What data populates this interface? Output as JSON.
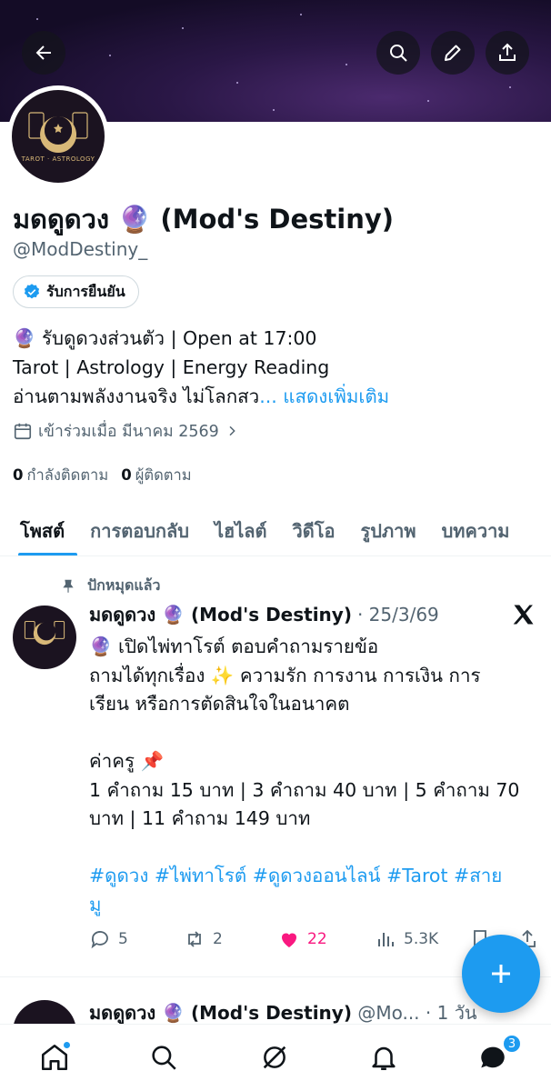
{
  "colors": {
    "accent": "#1d9bf0",
    "text": "#0f1419",
    "muted": "#536471",
    "like": "#f91880"
  },
  "profile": {
    "display_name": "มดดูดวง 🔮 (Mod's Destiny)",
    "handle": "@ModDestiny_",
    "verified_label": "รับการยืนยัน",
    "avatar_caption": "TAROT · ASTROLOGY",
    "bio_line1": "🔮 รับดูดวงส่วนตัว | Open at 17:00",
    "bio_line2": "Tarot | Astrology | Energy Reading",
    "bio_line3": "อ่านตามพลังงานจริง ไม่โลกสว",
    "bio_ellipsis": "... ",
    "bio_more": "แสดงเพิ่มเติม",
    "joined": "เข้าร่วมเมื่อ มีนาคม 2569",
    "following_count": "0",
    "following_label": "กำลังติดตาม",
    "followers_count": "0",
    "followers_label": "ผู้ติดตาม"
  },
  "tabs": [
    "โพสต์",
    "การตอบกลับ",
    "ไฮไลต์",
    "วิดีโอ",
    "รูปภาพ",
    "บทความ"
  ],
  "pinned_post": {
    "pinned_label": "ปักหมุดแล้ว",
    "author": "มดดูดวง 🔮 (Mod's Destiny)",
    "date": "· 25/3/69",
    "lines": [
      "🔮 เปิดไพ่ทาโรต์ ตอบคำถามรายข้อ",
      "ถามได้ทุกเรื่อง ✨ ความรัก การงาน การเงิน การ",
      "เรียน หรือการตัดสินใจในอนาคต",
      "",
      "ค่าครู 📌",
      "1 คำถาม 15 บาท | 3 คำถาม 40 บาท | 5 คำถาม 70",
      "บาท | 11 คำถาม 149 บาท",
      ""
    ],
    "hashtags_line1": "#ดูดวง #ไพ่ทาโรต์ #ดูดวงออนไลน์ #Tarot #สาย",
    "hashtags_line2": "มู",
    "replies": "5",
    "reposts": "2",
    "likes": "22",
    "views": "5.3K"
  },
  "second_post": {
    "author": "มดดูดวง 🔮 (Mod's Destiny)",
    "meta": " @Mo... · 1 วัน"
  },
  "nav": {
    "messages_badge": "3"
  }
}
